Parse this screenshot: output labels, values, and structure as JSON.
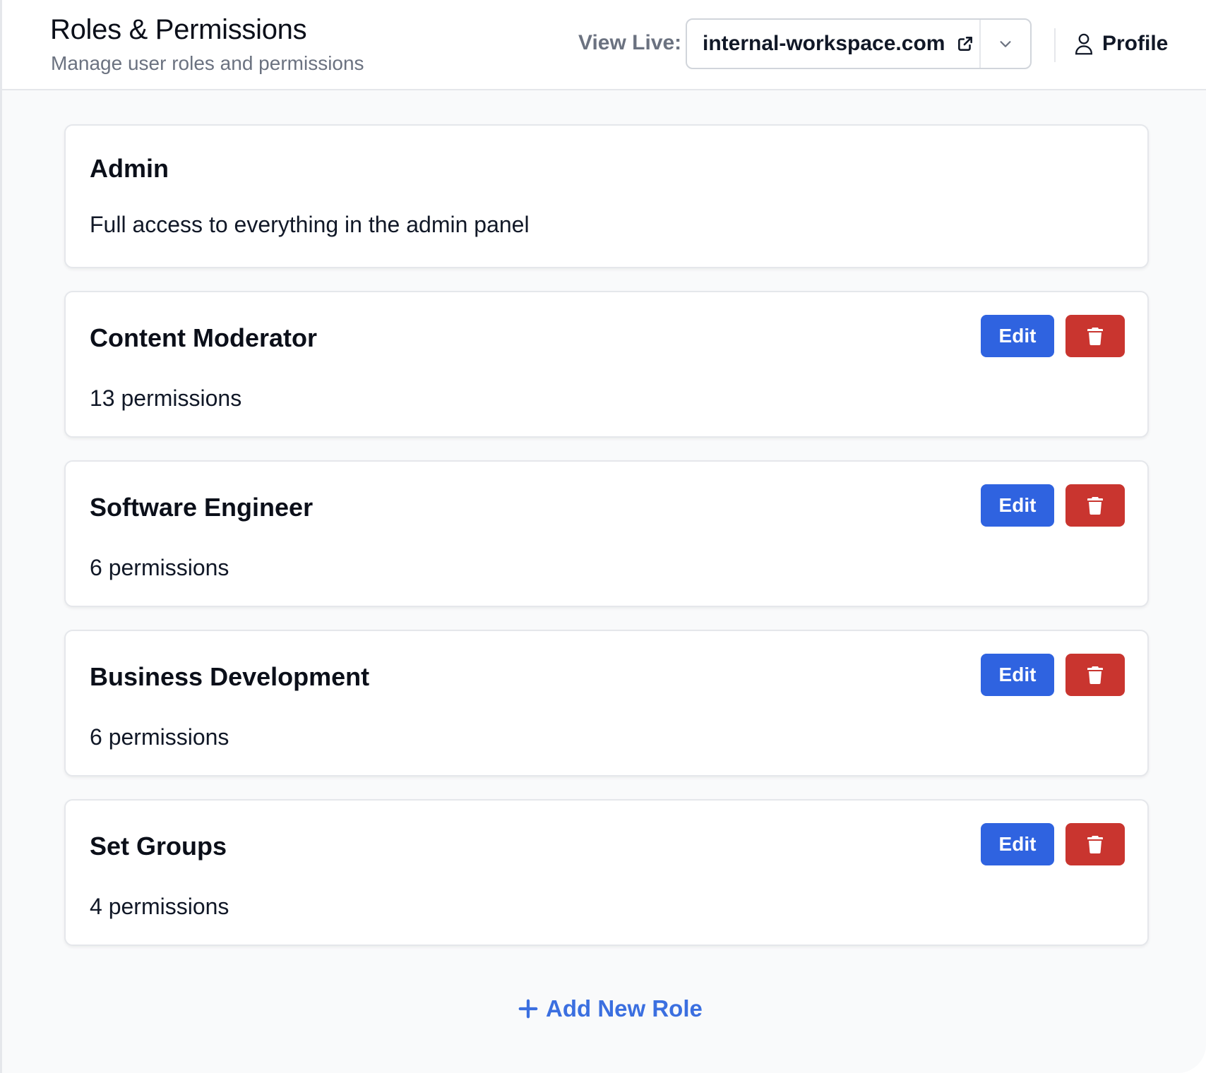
{
  "header": {
    "title": "Roles & Permissions",
    "subtitle": "Manage user roles and permissions",
    "view_live_label": "View Live:",
    "domain": "internal-workspace.com",
    "profile_label": "Profile"
  },
  "roles": [
    {
      "name": "Admin",
      "description": "Full access to everything in the admin panel",
      "editable": false
    },
    {
      "name": "Content Moderator",
      "description": "13 permissions",
      "editable": true
    },
    {
      "name": "Software Engineer",
      "description": "6 permissions",
      "editable": true
    },
    {
      "name": "Business Development",
      "description": "6 permissions",
      "editable": true
    },
    {
      "name": "Set Groups",
      "description": "4 permissions",
      "editable": true
    }
  ],
  "actions": {
    "edit_label": "Edit",
    "add_role_label": "Add New Role"
  },
  "icons": {
    "external_link": "external-link-icon",
    "dropdown": "chevron-down-icon",
    "profile": "user-icon",
    "delete": "trash-icon",
    "add": "plus-icon"
  },
  "colors": {
    "primary": "#2f63e0",
    "danger": "#c9352f",
    "link": "#3b6fe0"
  }
}
